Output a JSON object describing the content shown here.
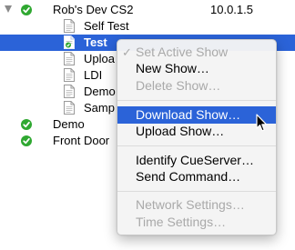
{
  "tree": {
    "root": {
      "name": "Rob's Dev CS2",
      "ip": "10.0.1.5",
      "expanded": true,
      "status": "online",
      "children": [
        {
          "name": "Self Test",
          "selected": false,
          "active": false
        },
        {
          "name": "Test",
          "selected": true,
          "active": true
        },
        {
          "name": "Uploa",
          "selected": false,
          "active": false
        },
        {
          "name": "LDI",
          "selected": false,
          "active": false
        },
        {
          "name": "Demo",
          "selected": false,
          "active": false
        },
        {
          "name": "Samp",
          "selected": false,
          "active": false
        }
      ]
    },
    "siblings": [
      {
        "name": "Demo",
        "status": "online"
      },
      {
        "name": "Front Door",
        "status": "online"
      }
    ]
  },
  "context_menu": {
    "groups": [
      [
        {
          "label": "Set Active Show",
          "enabled": false,
          "checked": true
        },
        {
          "label": "New Show…",
          "enabled": true,
          "checked": false
        },
        {
          "label": "Delete Show…",
          "enabled": false,
          "checked": false
        }
      ],
      [
        {
          "label": "Download Show…",
          "enabled": true,
          "checked": false,
          "highlighted": true
        },
        {
          "label": "Upload Show…",
          "enabled": true,
          "checked": false
        }
      ],
      [
        {
          "label": "Identify CueServer…",
          "enabled": true,
          "checked": false
        },
        {
          "label": "Send Command…",
          "enabled": true,
          "checked": false
        }
      ],
      [
        {
          "label": "Network Settings…",
          "enabled": false,
          "checked": false
        },
        {
          "label": "Time Settings…",
          "enabled": false,
          "checked": false
        }
      ]
    ]
  },
  "colors": {
    "selection": "#2b63d8",
    "status_online": "#2fa831",
    "disabled_text": "#a9a9a9"
  },
  "icons": {
    "disclosure": "disclosure-triangle-icon",
    "status": "check-circle-icon",
    "document": "document-icon",
    "active_document": "active-document-icon",
    "menu_check": "checkmark-icon",
    "cursor": "mouse-pointer-icon"
  }
}
